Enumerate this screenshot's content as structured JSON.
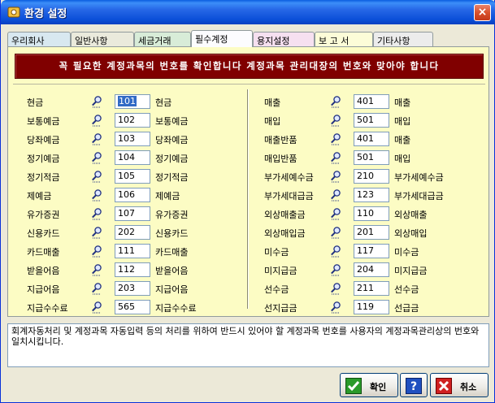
{
  "window": {
    "title": "환경 설정",
    "close_label": "×"
  },
  "tabs": [
    {
      "label": "우리회사"
    },
    {
      "label": "일반사항"
    },
    {
      "label": "세금거래"
    },
    {
      "label": "필수계정"
    },
    {
      "label": "용지설정"
    },
    {
      "label": "보 고 서"
    },
    {
      "label": "기타사항"
    }
  ],
  "active_tab": "필수계정",
  "banner": "꼭 필요한 계정과목의 번호를 확인합니다   계정과목 관리대장의 번호와 맞아야 합니다",
  "left_accounts": [
    {
      "label": "현금",
      "code": "101",
      "name": "현금"
    },
    {
      "label": "보통예금",
      "code": "102",
      "name": "보통예금"
    },
    {
      "label": "당좌예금",
      "code": "103",
      "name": "당좌예금"
    },
    {
      "label": "정기예금",
      "code": "104",
      "name": "정기예금"
    },
    {
      "label": "정기적금",
      "code": "105",
      "name": "정기적금"
    },
    {
      "label": "제예금",
      "code": "106",
      "name": "제예금"
    },
    {
      "label": "유가증권",
      "code": "107",
      "name": "유가증권"
    },
    {
      "label": "신용카드",
      "code": "202",
      "name": "신용카드"
    },
    {
      "label": "카드매출",
      "code": "111",
      "name": "카드매출"
    },
    {
      "label": "받을어음",
      "code": "112",
      "name": "받을어음"
    },
    {
      "label": "지급어음",
      "code": "203",
      "name": "지급어음"
    },
    {
      "label": "지급수수료",
      "code": "565",
      "name": "지급수수료"
    }
  ],
  "right_accounts": [
    {
      "label": "매출",
      "code": "401",
      "name": "매출"
    },
    {
      "label": "매입",
      "code": "501",
      "name": "매입"
    },
    {
      "label": "매출반품",
      "code": "401",
      "name": "매출"
    },
    {
      "label": "매입반품",
      "code": "501",
      "name": "매입"
    },
    {
      "label": "부가세예수금",
      "code": "210",
      "name": "부가세예수금"
    },
    {
      "label": "부가세대급금",
      "code": "123",
      "name": "부가세대급금"
    },
    {
      "label": "외상매출금",
      "code": "110",
      "name": "외상매출"
    },
    {
      "label": "외상매입금",
      "code": "201",
      "name": "외상매입"
    },
    {
      "label": "미수금",
      "code": "117",
      "name": "미수금"
    },
    {
      "label": "미지급금",
      "code": "204",
      "name": "미지급금"
    },
    {
      "label": "선수금",
      "code": "211",
      "name": "선수금"
    },
    {
      "label": "선지급금",
      "code": "119",
      "name": "선급금"
    }
  ],
  "description": "회계자동처리 및 계정과목 자동입력 등의 처리를 위하여 반드시 있어야 할 계정과목 번호를 사용자의 계정과목관리상의 번호와 일치시킵니다.",
  "buttons": {
    "ok": "확인",
    "help": "?",
    "cancel": "취소"
  },
  "colors": {
    "banner": "#800000",
    "panel": "#fcfcc4",
    "titlebar": "#0a4fd8"
  },
  "icons": {
    "lookup": "magnifier-icon",
    "ok": "check-icon",
    "help": "help-icon",
    "cancel": "x-icon",
    "title": "settings-icon"
  }
}
